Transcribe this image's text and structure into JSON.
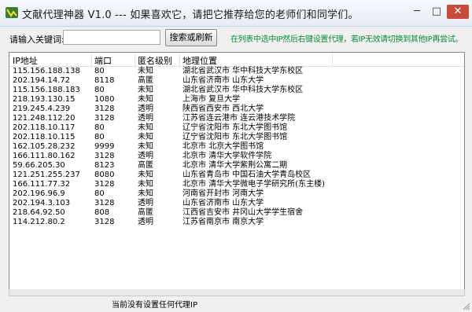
{
  "window": {
    "title": "文献代理神器 V1.0  ---  如果喜欢它，请把它推荐给您的老师们和同学们。",
    "minimize": "─",
    "maximize": "□",
    "close": "✕"
  },
  "toolbar": {
    "search_label": "请输入关键词:",
    "search_value": "",
    "search_button": "搜索或刷新",
    "hint": "在列表中选中IP然后右键设置代理，若IP无效请切换到其他IP再尝试。"
  },
  "table": {
    "columns": [
      "IP地址",
      "端口",
      "匿名级别",
      "地理位置"
    ],
    "rows": [
      [
        "115.156.188.138",
        "80",
        "未知",
        "湖北省武汉市 华中科技大学东校区"
      ],
      [
        "202.194.14.72",
        "8118",
        "高匿",
        "山东省济南市 山东大学"
      ],
      [
        "115.156.188.183",
        "80",
        "未知",
        "湖北省武汉市 华中科技大学东校区"
      ],
      [
        "218.193.130.15",
        "1080",
        "未知",
        "上海市 复旦大学"
      ],
      [
        "219.245.4.239",
        "3128",
        "透明",
        "陕西省西安市 西北大学"
      ],
      [
        "121.248.112.20",
        "3128",
        "透明",
        "江苏省连云港市 连云港技术学院"
      ],
      [
        "202.118.10.117",
        "80",
        "未知",
        "辽宁省沈阳市 东北大学图书馆"
      ],
      [
        "202.118.10.115",
        "80",
        "未知",
        "辽宁省沈阳市 东北大学图书馆"
      ],
      [
        "162.105.28.232",
        "9999",
        "未知",
        "北京市 北京大学图书馆"
      ],
      [
        "166.111.80.162",
        "3128",
        "透明",
        "北京市 清华大学软件学院"
      ],
      [
        "59.66.205.30",
        "8123",
        "高匿",
        "北京市 清华大学紫荆公寓二期"
      ],
      [
        "121.251.255.237",
        "8080",
        "未知",
        "山东省青岛市 中国石油大学青岛校区"
      ],
      [
        "166.111.77.32",
        "3128",
        "未知",
        "北京市 清华大学微电子学研究所(东主楼)"
      ],
      [
        "202.196.96.9",
        "80",
        "未知",
        "河南省开封市 河南大学"
      ],
      [
        "202.194.3.103",
        "3128",
        "透明",
        "山东省济南市 山东大学"
      ],
      [
        "218.64.92.50",
        "808",
        "高匿",
        "江西省吉安市 井冈山大学学生宿舍"
      ],
      [
        "114.212.80.2",
        "3128",
        "透明",
        "江苏省南京市 南京大学"
      ]
    ]
  },
  "status": {
    "text": "当前没有设置任何代理IP"
  },
  "colors": {
    "hint": "#0a8a36",
    "close_button": "#c74c3c"
  },
  "icons": [
    "app-logo-icon",
    "resize-grip-icon"
  ]
}
